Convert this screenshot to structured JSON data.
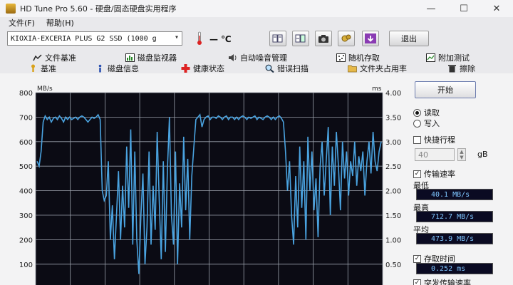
{
  "window": {
    "title": "HD Tune Pro 5.60 - 硬盘/固态硬盘实用程序",
    "minimize": "—",
    "maximize": "☐",
    "close": "✕"
  },
  "menu": {
    "file": "文件(F)",
    "help": "帮助(H)"
  },
  "toolbar": {
    "drive": "KIOXIA-EXCERIA PLUS G2 SSD (1000 g",
    "temperature": "— ℃",
    "exit": "退出"
  },
  "tabs_top": [
    "文件基准",
    "磁盘监视器",
    "自动噪音管理",
    "随机存取",
    "附加测试"
  ],
  "tabs_bottom": [
    "基准",
    "磁盘信息",
    "健康状态",
    "错误扫描",
    "文件夹占用率",
    "擦除"
  ],
  "side": {
    "start": "开始",
    "read": "读取",
    "write": "写入",
    "short_stroke": "快捷行程",
    "short_stroke_value": "40",
    "short_stroke_unit": "gB",
    "transfer_rate": "传输速率",
    "min_label": "最低",
    "min_value": "40.1 MB/s",
    "max_label": "最高",
    "max_value": "712.7 MB/s",
    "avg_label": "平均",
    "avg_value": "473.9 MB/s",
    "access_time": "存取时间",
    "access_value": "0.252 ms",
    "burst_rate": "突发传输速率"
  },
  "chart_data": {
    "type": "line",
    "left_axis_unit": "MB/s",
    "right_axis_unit": "ms",
    "left_ticks": [
      "800",
      "700",
      "600",
      "500",
      "400",
      "300",
      "200",
      "100"
    ],
    "right_ticks": [
      "4.00",
      "3.50",
      "3.00",
      "2.50",
      "2.00",
      "1.50",
      "1.00",
      "0.50"
    ],
    "ylim_left": [
      0,
      800
    ],
    "ylim_right": [
      0,
      4
    ],
    "grid": true,
    "series": [
      {
        "values": [
          520,
          500,
          560,
          680,
          705,
          690,
          700,
          680,
          695,
          700,
          690,
          705,
          695,
          680,
          700,
          690,
          700,
          690,
          695,
          700,
          690,
          700,
          705,
          700,
          690,
          680,
          690,
          700,
          695,
          700,
          710,
          690,
          400,
          360,
          380,
          520,
          200,
          340,
          120,
          300,
          480,
          200,
          420,
          250,
          580,
          330,
          650,
          180,
          560,
          200,
          60,
          300,
          470,
          100,
          250,
          560,
          180,
          420,
          240,
          640,
          360,
          120,
          520,
          150,
          480,
          700,
          300,
          180,
          560,
          100,
          430,
          250,
          620,
          320,
          530,
          200,
          460,
          580,
          690,
          700,
          710,
          660,
          690,
          700,
          705,
          690,
          700,
          700,
          695,
          705,
          700,
          690,
          700,
          705,
          690,
          700,
          700,
          690,
          700,
          690,
          700,
          705,
          700,
          690,
          700,
          695,
          700,
          705,
          690,
          700,
          695,
          690,
          700,
          705,
          700,
          690,
          700,
          690,
          700,
          705,
          695,
          680,
          560,
          400,
          520,
          300,
          180,
          460,
          250,
          580,
          330,
          520,
          200,
          620,
          400,
          560,
          320,
          450,
          210,
          500,
          600,
          380,
          520,
          660,
          300,
          580,
          420,
          640,
          500,
          320,
          600,
          450,
          560,
          380,
          520,
          460,
          600,
          420,
          540,
          480,
          560,
          380,
          520,
          600,
          470,
          640,
          520,
          480,
          560,
          600
        ]
      }
    ]
  }
}
